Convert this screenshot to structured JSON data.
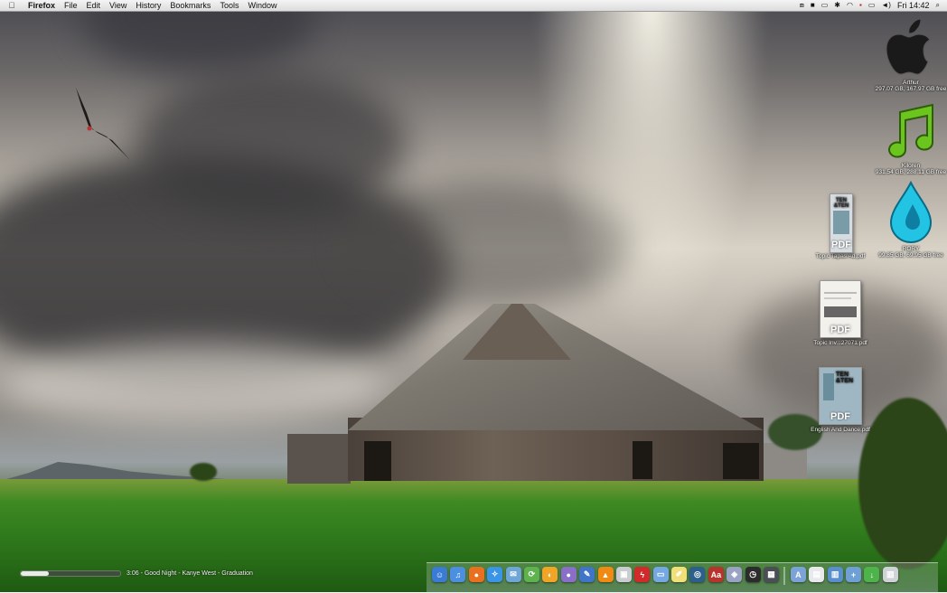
{
  "menubar": {
    "apple_icon": "apple-icon",
    "app_name": "Firefox",
    "menus": [
      "File",
      "Edit",
      "View",
      "History",
      "Bookmarks",
      "Tools",
      "Window"
    ],
    "status_icons": [
      "dropbox-icon",
      "screen-icon",
      "display-icon",
      "bluetooth-icon",
      "wifi-icon",
      "flag-icon",
      "battery-icon",
      "volume-icon"
    ],
    "clock": "Fri 14:42",
    "spotlight_icon": "search-icon"
  },
  "desktop": {
    "drives": [
      {
        "name": "Arthur",
        "info": "297.07 GB, 167.97 GB free",
        "icon": "apple-logo-icon"
      },
      {
        "name": "Kiloren",
        "info": "931.54 GB, 288.11 GB free",
        "icon": "music-note-icon"
      },
      {
        "name": "RORY",
        "info": "99.85 GB, 69.95 GB free",
        "icon": "water-drop-icon"
      }
    ],
    "files": [
      {
        "name": "Topic Tapas Ad.pdf",
        "badge": "PDF",
        "cover": "TEN\n&TEN"
      },
      {
        "name": "Topic Inv...27071.pdf",
        "badge": "PDF",
        "cover": ""
      },
      {
        "name": "English And Dance.pdf",
        "badge": "PDF",
        "cover": "TEN\n&TEN"
      }
    ]
  },
  "now_playing": {
    "progress": 0.28,
    "text": "3:06 - Good Night - Kanye West - Graduation"
  },
  "dock": {
    "items": [
      {
        "name": "finder-icon",
        "color": "#3a7bd5",
        "glyph": "☺"
      },
      {
        "name": "itunes-icon",
        "color": "#4c8fe0",
        "glyph": "♫"
      },
      {
        "name": "firefox-icon",
        "color": "#e8701f",
        "glyph": "●"
      },
      {
        "name": "safari-icon",
        "color": "#3b95e6",
        "glyph": "✧"
      },
      {
        "name": "mail-icon",
        "color": "#6fa6d8",
        "glyph": "✉"
      },
      {
        "name": "sync-icon",
        "color": "#5fb34f",
        "glyph": "⟳"
      },
      {
        "name": "adium-icon",
        "color": "#f0a526",
        "glyph": "◐"
      },
      {
        "name": "ball-icon",
        "color": "#8a6fc9",
        "glyph": "●"
      },
      {
        "name": "feather-icon",
        "color": "#3f74c9",
        "glyph": "✎"
      },
      {
        "name": "vlc-icon",
        "color": "#f18a13",
        "glyph": "▲"
      },
      {
        "name": "camera-icon",
        "color": "#c9ccd0",
        "glyph": "▣"
      },
      {
        "name": "flash-icon",
        "color": "#d22a2a",
        "glyph": "ϟ"
      },
      {
        "name": "folder-icon",
        "color": "#75a8e0",
        "glyph": "▭"
      },
      {
        "name": "notes-icon",
        "color": "#f1e07a",
        "glyph": "✐"
      },
      {
        "name": "aperture-icon",
        "color": "#2d5f8c",
        "glyph": "◎"
      },
      {
        "name": "dictionary-icon",
        "color": "#b8332b",
        "glyph": "Aa"
      },
      {
        "name": "cube-icon",
        "color": "#9aa3c4",
        "glyph": "◈"
      },
      {
        "name": "clock-icon",
        "color": "#2c2c2c",
        "glyph": "◷"
      },
      {
        "name": "screen-capture-icon",
        "color": "#4b4f55",
        "glyph": "▦"
      },
      {
        "name": "applications-icon",
        "color": "#7ba3d8",
        "glyph": "A"
      },
      {
        "name": "documents-icon",
        "color": "#e7e9ec",
        "glyph": "▤"
      },
      {
        "name": "pictures-icon",
        "color": "#5a8fcf",
        "glyph": "▥"
      },
      {
        "name": "pictures-folder-icon",
        "color": "#6ea0d6",
        "glyph": "+"
      },
      {
        "name": "downloads-icon",
        "color": "#4fb34b",
        "glyph": "↓"
      },
      {
        "name": "trash-icon",
        "color": "#cfd3d8",
        "glyph": "▥"
      }
    ]
  }
}
